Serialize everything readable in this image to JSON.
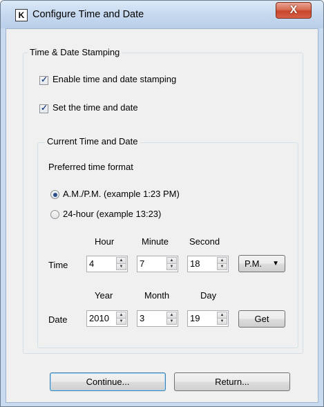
{
  "window": {
    "app_icon_letter": "K",
    "title": "Configure Time and Date",
    "close_glyph": "X"
  },
  "stamping": {
    "legend": "Time & Date Stamping",
    "enable": {
      "label": "Enable time and date stamping",
      "checked": true
    },
    "set_time": {
      "label": "Set the time and date",
      "checked": true
    }
  },
  "current": {
    "legend": "Current Time and Date",
    "preferred_label": "Preferred time format",
    "format_ampm": {
      "label": "A.M./P.M. (example 1:23 PM)",
      "selected": true
    },
    "format_24": {
      "label": "24-hour (example 13:23)",
      "selected": false
    },
    "time_headers": {
      "hour": "Hour",
      "minute": "Minute",
      "second": "Second"
    },
    "time_row_label": "Time",
    "hour": "4",
    "minute": "7",
    "second": "18",
    "ampm": "P.M.",
    "date_headers": {
      "year": "Year",
      "month": "Month",
      "day": "Day"
    },
    "date_row_label": "Date",
    "year": "2010",
    "month": "3",
    "day": "19",
    "get_label": "Get"
  },
  "buttons": {
    "continue_label": "Continue...",
    "return_label": "Return..."
  },
  "colors": {
    "frame": "#c8daf0",
    "client": "#f0f0f0",
    "close_button": "#c7462c",
    "default_button_border": "#3c7fb1"
  }
}
